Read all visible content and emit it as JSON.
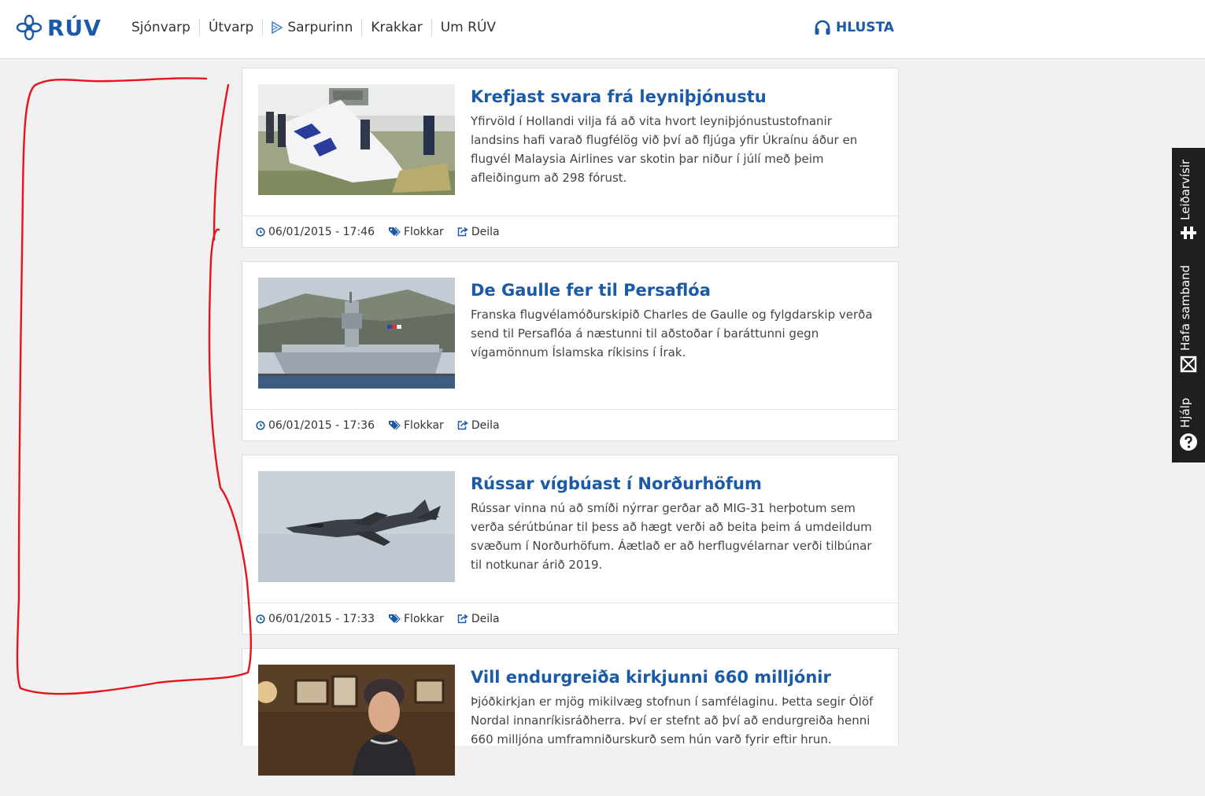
{
  "brand": {
    "name": "RÚV",
    "color": "#1b5aa6"
  },
  "nav": {
    "items": [
      {
        "label": "Sjónvarp"
      },
      {
        "label": "Útvarp"
      },
      {
        "label": "Sarpurinn",
        "icon": "play-icon"
      },
      {
        "label": "Krakkar"
      },
      {
        "label": "Um RÚV"
      }
    ],
    "listen_label": "HLUSTA",
    "listen_icon": "headphones-icon"
  },
  "articles": [
    {
      "title": "Krefjast svara frá leyniþjónustu",
      "summary": "Yfirvöld í Hollandi vilja fá að vita hvort leyniþjónustustofnanir landsins hafi varað flugfélög við því að fljúga yfir Úkraínu áður en flugvél Malaysia Airlines var skotin þar niður í júlí með þeim afleiðingum að 298 fórust.",
      "datetime": "06/01/2015 - 17:46",
      "categories_label": "Flokkar",
      "share_label": "Deila",
      "image": "plane-wreckage-photo"
    },
    {
      "title": "De Gaulle fer til Persaflóa",
      "summary": "Franska flugvélamóðurskipið Charles de Gaulle og fylgdarskip verða send til Persaflóa á næstunni til aðstoðar í baráttunni gegn vígamönnum Íslamska ríkisins í Írak.",
      "datetime": "06/01/2015 - 17:36",
      "categories_label": "Flokkar",
      "share_label": "Deila",
      "image": "aircraft-carrier-photo"
    },
    {
      "title": "Rússar vígbúast í Norðurhöfum",
      "summary": "Rússar vinna nú að smíði nýrrar gerðar að MIG-31 herþotum sem verða sérútbúnar til þess að hægt verði að beita þeim á umdeildum svæðum í Norðurhöfum. Áætlað er að herflugvélarnar verði tilbúnar til notkunar árið 2019.",
      "datetime": "06/01/2015 - 17:33",
      "categories_label": "Flokkar",
      "share_label": "Deila",
      "image": "fighter-jet-photo"
    },
    {
      "title": "Vill endurgreiða kirkjunni 660 milljónir",
      "summary": "Þjóðkirkjan er mjög mikilvæg stofnun í samfélaginu. Þetta segir Ólöf Nordal innanríkisráðherra. Því er stefnt að því að endurgreiða henni 660 milljóna umframniðurskurð sem hún varð fyrir eftir hrun.",
      "image": "minister-portrait-photo"
    }
  ],
  "side_tab": {
    "items": [
      {
        "label": "Leiðarvísir",
        "icon": "accessibility-icon"
      },
      {
        "label": "Hafa samband",
        "icon": "envelope-icon"
      },
      {
        "label": "Hjálp",
        "icon": "help-icon"
      }
    ]
  },
  "annotation": {
    "color": "#e8141b",
    "shape": "freehand-outline"
  }
}
